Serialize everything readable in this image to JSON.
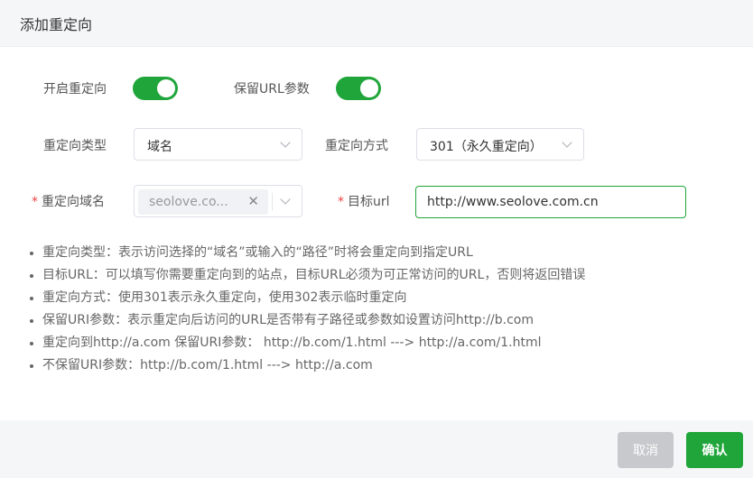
{
  "dialog": {
    "title": "添加重定向"
  },
  "form": {
    "enable_redirect": {
      "label": "开启重定向",
      "on": true
    },
    "keep_url_params": {
      "label": "保留URL参数",
      "on": true
    },
    "redirect_type": {
      "label": "重定向类型",
      "value": "域名"
    },
    "redirect_method": {
      "label": "重定向方式",
      "value": "301（永久重定向）"
    },
    "redirect_domain": {
      "required_mark": "*",
      "label": "重定向域名",
      "tag": "seolove.co..."
    },
    "target_url": {
      "required_mark": "*",
      "label": "目标url",
      "value": "http://www.seolove.com.cn"
    }
  },
  "tips": [
    "重定向类型：表示访问选择的“域名”或输入的“路径”时将会重定向到指定URL",
    "目标URL：可以填写你需要重定向到的站点，目标URL必须为可正常访问的URL，否则将返回错误",
    "重定向方式：使用301表示永久重定向，使用302表示临时重定向",
    "保留URI参数：表示重定向后访问的URL是否带有子路径或参数如设置访问http://b.com",
    "重定向到http://a.com 保留URI参数：  http://b.com/1.html ---> http://a.com/1.html",
    "不保留URI参数：http://b.com/1.html ---> http://a.com"
  ],
  "footer": {
    "cancel_label": "取消",
    "confirm_label": "确认"
  },
  "colors": {
    "accent": "#20a53a",
    "required": "#ef4444",
    "cancel_bg": "#c8c9cc"
  }
}
